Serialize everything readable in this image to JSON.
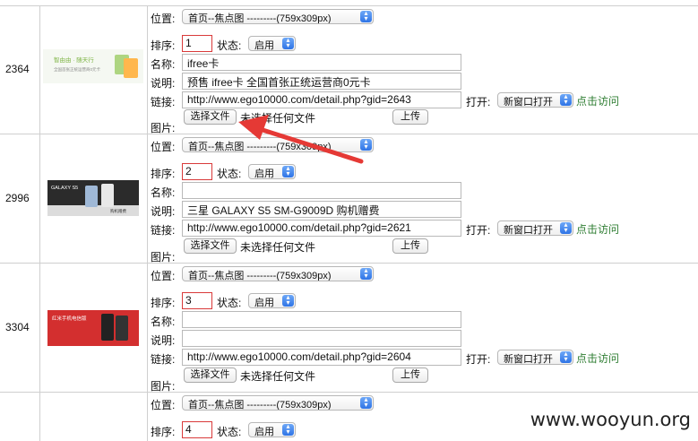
{
  "labels": {
    "position": "位置:",
    "order": "排序:",
    "status": "状态:",
    "name": "名称:",
    "desc": "说明:",
    "link": "链接:",
    "open": "打开:",
    "image": "图片:",
    "choose_file": "选择文件",
    "no_file": "未选择任何文件",
    "upload": "上传",
    "visit": "点击访问"
  },
  "rows": [
    {
      "id": "2364",
      "position": "首页--焦点图 ---------(759x309px)",
      "order": "1",
      "status": "启用",
      "name": "ifree卡",
      "desc": "预售 ifree卡 全国首张正统运营商0元卡",
      "link": "http://www.ego10000.com/detail.php?gid=2643",
      "open": "新窗口打开",
      "thumb_text": "智由由 · 随天行",
      "thumb_sub": "全国首张正统运营商0元卡"
    },
    {
      "id": "2996",
      "position": "首页--焦点图 ---------(759x309px)",
      "order": "2",
      "status": "启用",
      "name": "",
      "desc": "三星 GALAXY S5 SM-G9009D 购机赠费",
      "link": "http://www.ego10000.com/detail.php?gid=2621",
      "open": "新窗口打开",
      "thumb_text": "GALAXY S5",
      "thumb_sub": "购机赠费"
    },
    {
      "id": "3304",
      "position": "首页--焦点图 ---------(759x309px)",
      "order": "3",
      "status": "启用",
      "name": "",
      "desc": "",
      "link": "http://www.ego10000.com/detail.php?gid=2604",
      "open": "新窗口打开",
      "thumb_text": "红米手机电信版"
    },
    {
      "position": "首页--焦点图 ---------(759x309px)",
      "order": "4",
      "status": "启用"
    }
  ],
  "watermark": "www.wooyun.org",
  "colors": {
    "arrow": "#e53935",
    "visit_link": "#2e7d32",
    "order_border": "#d93a3a",
    "select_arrow": "#2f74e6"
  }
}
